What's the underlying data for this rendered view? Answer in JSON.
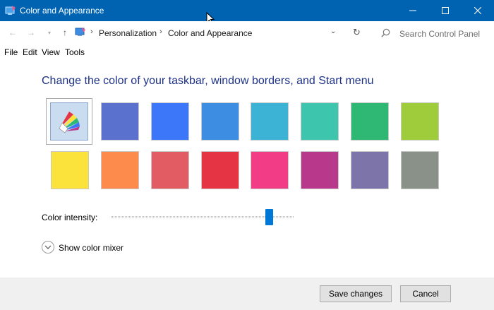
{
  "window": {
    "title": "Color and Appearance",
    "accent_color": "#0063b1",
    "controls": {
      "minimize_glyph": "—",
      "maximize_glyph": "☐",
      "close_glyph": "✕"
    }
  },
  "nav": {
    "back_glyph": "←",
    "forward_glyph": "→",
    "recent_glyph": "▾",
    "up_glyph": "↑",
    "breadcrumb": [
      "Personalization",
      "Color and Appearance"
    ],
    "separator_glyph": "›",
    "dropdown_glyph": "⌄",
    "refresh_glyph": "↻",
    "search_placeholder": "Search Control Panel"
  },
  "menu": [
    "File",
    "Edit",
    "View",
    "Tools"
  ],
  "main": {
    "heading": "Change the color of your taskbar, window borders, and Start menu",
    "swatches_row1": [
      {
        "id": "auto",
        "icon": "color-palette-icon"
      },
      {
        "id": "color-2",
        "color": "#5a72cd"
      },
      {
        "id": "color-3",
        "color": "#3d77f9"
      },
      {
        "id": "color-4",
        "color": "#3d8ee2"
      },
      {
        "id": "color-5",
        "color": "#3cb3d4"
      },
      {
        "id": "color-6",
        "color": "#3ec5ae"
      },
      {
        "id": "color-7",
        "color": "#2fb873"
      },
      {
        "id": "color-8",
        "color": "#9fcc3b"
      }
    ],
    "swatches_row2": [
      {
        "id": "color-9",
        "color": "#fce33c"
      },
      {
        "id": "color-10",
        "color": "#fd8b4c"
      },
      {
        "id": "color-11",
        "color": "#e25c63"
      },
      {
        "id": "color-12",
        "color": "#e53444"
      },
      {
        "id": "color-13",
        "color": "#f23c85"
      },
      {
        "id": "color-14",
        "color": "#b8388c"
      },
      {
        "id": "color-15",
        "color": "#7d74aa"
      },
      {
        "id": "color-16",
        "color": "#8a9188"
      }
    ],
    "intensity_label": "Color intensity:",
    "intensity_value": 0.86,
    "mixer_label": "Show color mixer"
  },
  "footer": {
    "save_label": "Save changes",
    "cancel_label": "Cancel"
  }
}
